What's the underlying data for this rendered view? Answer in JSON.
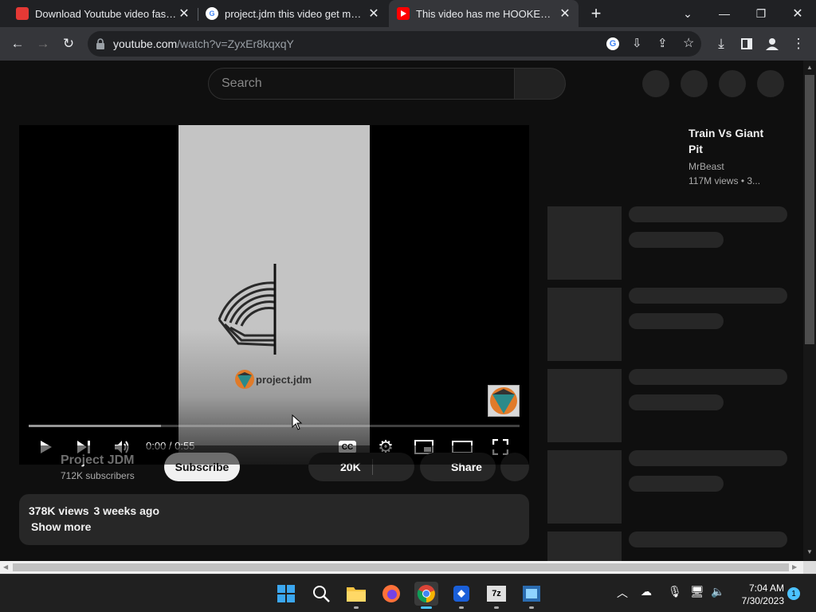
{
  "browser": {
    "tabs": [
      {
        "title": "Download Youtube video fast, co",
        "favicon": "savefrom-icon",
        "color": "#e53935"
      },
      {
        "title": "project.jdm this video get me ho",
        "favicon": "google-icon",
        "color": "#ffffff"
      },
      {
        "title": "This video has me HOOKED - You",
        "favicon": "youtube-icon",
        "color": "#ff0000"
      }
    ],
    "url_host": "youtube.com",
    "url_path": "/watch?v=ZyxEr8kqxqY"
  },
  "youtube": {
    "search_placeholder": "Search",
    "player": {
      "time": "0:00 / 0:55",
      "watermark_text": "project.jdm",
      "cc_label": "CC"
    },
    "owner": {
      "name": "Project JDM",
      "subscribers": "712K subscribers"
    },
    "subscribe_label": "Subscribe",
    "like_count": "20K",
    "share_label": "Share",
    "description": {
      "views": "378K views",
      "date": "3 weeks ago",
      "show_more": "Show more"
    },
    "recommended": {
      "title": "Train Vs Giant Pit",
      "channel": "MrBeast",
      "views": "117M views",
      "meta_rest": "• 3..."
    }
  },
  "taskbar": {
    "time": "7:04 AM",
    "date": "7/30/2023",
    "notification_count": "1"
  }
}
